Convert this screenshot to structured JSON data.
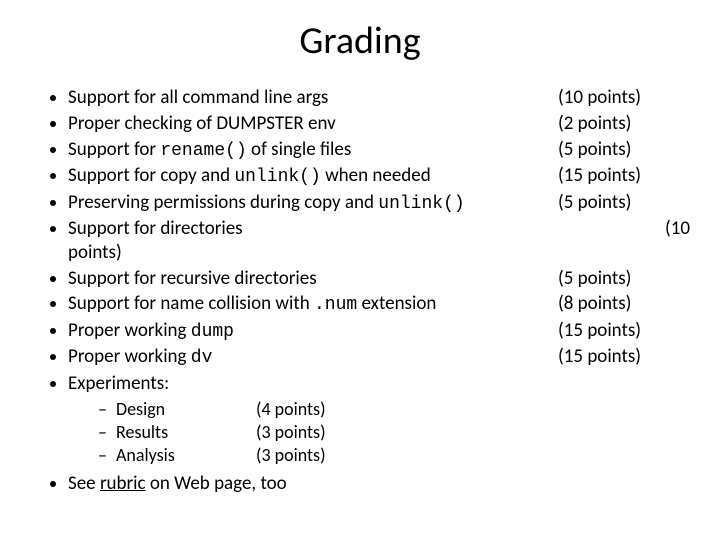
{
  "title": "Grading",
  "items": [
    {
      "text_pre": "Support for all command line args",
      "text_mono": "",
      "text_post": "",
      "points": "(10 points)"
    },
    {
      "text_pre": "Proper checking of DUMPSTER env",
      "text_mono": "",
      "text_post": "",
      "points": "(2 points)"
    },
    {
      "text_pre": "Support for ",
      "text_mono": "rename()",
      "text_post": " of single files",
      "points": "(5 points)"
    },
    {
      "text_pre": "Support for copy and ",
      "text_mono": "unlink()",
      "text_post": " when needed",
      "points": "(15 points)"
    },
    {
      "text_pre": "Preserving permissions during copy and ",
      "text_mono": "unlink()",
      "text_post": "",
      "points": "(5 points)"
    },
    {
      "text_pre": "Support for directories",
      "text_mono": "",
      "text_post": "",
      "points": "(10",
      "points_wrap": "points)"
    },
    {
      "text_pre": "Support for recursive directories",
      "text_mono": "",
      "text_post": "",
      "points": "(5 points)"
    },
    {
      "text_pre": "Support for name collision with ",
      "text_mono": ".num",
      "text_post": " extension",
      "points": "(8 points)"
    },
    {
      "text_pre": "Proper working ",
      "text_mono": "dump",
      "text_post": "",
      "points": "(15 points)"
    },
    {
      "text_pre": "Proper working ",
      "text_mono": "dv",
      "text_post": "",
      "points": "(15 points)"
    },
    {
      "text_pre": "Experiments:",
      "text_mono": "",
      "text_post": "",
      "points": ""
    }
  ],
  "sub": [
    {
      "label": "Design",
      "points": "(4 points)"
    },
    {
      "label": "Results",
      "points": "(3 points)"
    },
    {
      "label": "Analysis",
      "points": "(3 points)"
    }
  ],
  "footer": {
    "pre": "See ",
    "link": "rubric",
    "post": " on Web page, too"
  }
}
